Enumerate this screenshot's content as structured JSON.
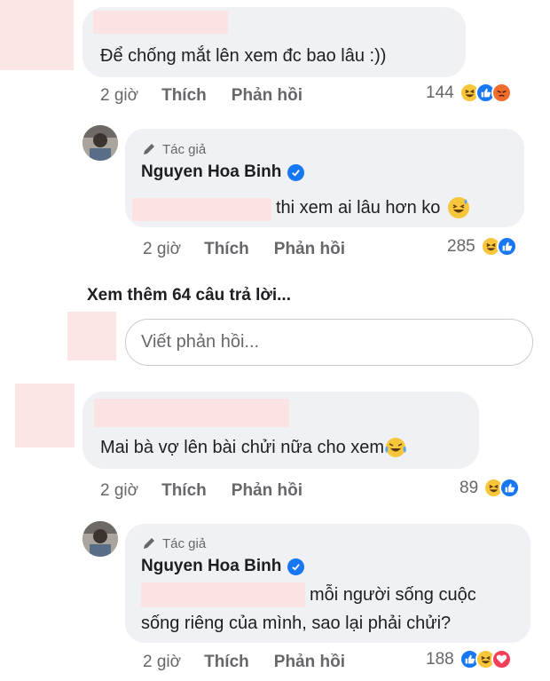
{
  "comments": [
    {
      "text": "Để chống mắt lên xem đc bao lâu :))",
      "time": "2 giờ",
      "like": "Thích",
      "reply": "Phản hồi",
      "count": "144",
      "reply_item": {
        "author_tag": "Tác giả",
        "author_name": "Nguyen Hoa Binh",
        "text": "thi xem ai lâu hơn ko",
        "time": "2 giờ",
        "like": "Thích",
        "reply": "Phản hồi",
        "count": "285"
      }
    },
    {
      "text": "Mai bà vợ lên bài chửi nữa cho xem",
      "time": "2 giờ",
      "like": "Thích",
      "reply": "Phản hồi",
      "count": "89",
      "reply_item": {
        "author_tag": "Tác giả",
        "author_name": "Nguyen Hoa Binh",
        "text_line1": "mỗi người sống cuộc",
        "text_line2": "sống riêng của mình, sao lại phải chửi?",
        "time": "2 giờ",
        "like": "Thích",
        "reply": "Phản hồi",
        "count": "188"
      }
    }
  ],
  "more_replies": "Xem thêm 64 câu trả lời...",
  "reply_input": {
    "placeholder": "Viết phản hồi..."
  },
  "colors": {
    "like_blue": "#1877f2",
    "haha_yellow": "#f7c63b",
    "angry_orange": "#f06c2c",
    "love_red": "#f33e58",
    "redact_pink": "#fbe3e3"
  },
  "icons": [
    "pencil-icon",
    "verified-icon",
    "haha-reaction-icon",
    "like-reaction-icon",
    "angry-reaction-icon",
    "love-reaction-icon",
    "sweat-smile-emoji",
    "tears-of-joy-emoji"
  ]
}
